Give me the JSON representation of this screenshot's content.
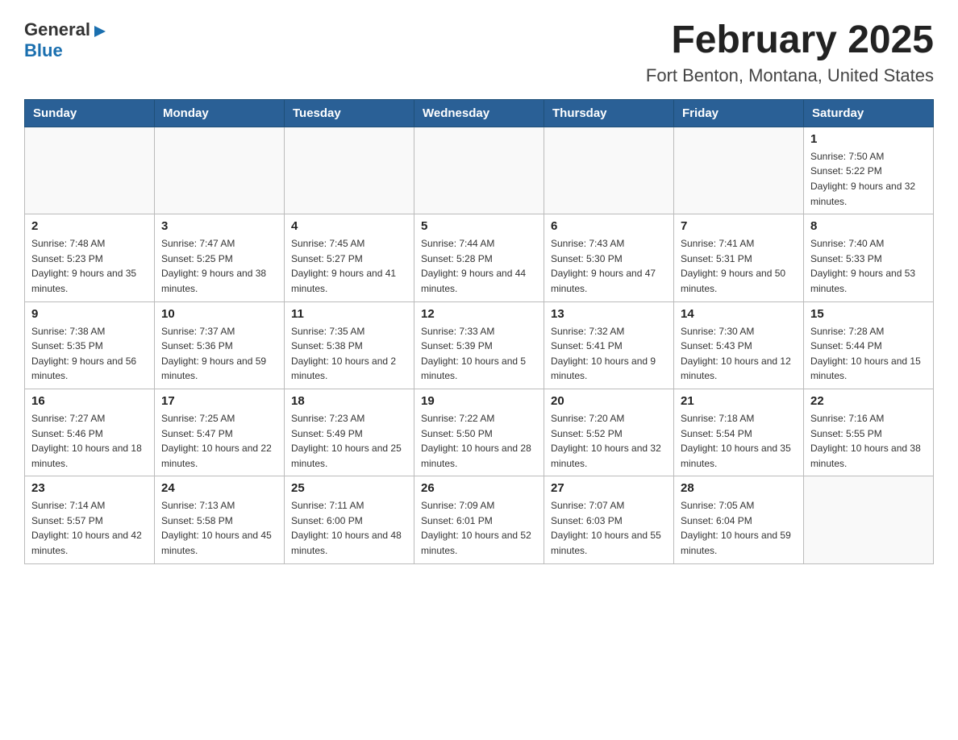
{
  "header": {
    "logo": {
      "general": "General",
      "blue": "Blue"
    },
    "title": "February 2025",
    "subtitle": "Fort Benton, Montana, United States"
  },
  "days_of_week": [
    "Sunday",
    "Monday",
    "Tuesday",
    "Wednesday",
    "Thursday",
    "Friday",
    "Saturday"
  ],
  "weeks": [
    [
      {
        "day": "",
        "info": ""
      },
      {
        "day": "",
        "info": ""
      },
      {
        "day": "",
        "info": ""
      },
      {
        "day": "",
        "info": ""
      },
      {
        "day": "",
        "info": ""
      },
      {
        "day": "",
        "info": ""
      },
      {
        "day": "1",
        "info": "Sunrise: 7:50 AM\nSunset: 5:22 PM\nDaylight: 9 hours and 32 minutes."
      }
    ],
    [
      {
        "day": "2",
        "info": "Sunrise: 7:48 AM\nSunset: 5:23 PM\nDaylight: 9 hours and 35 minutes."
      },
      {
        "day": "3",
        "info": "Sunrise: 7:47 AM\nSunset: 5:25 PM\nDaylight: 9 hours and 38 minutes."
      },
      {
        "day": "4",
        "info": "Sunrise: 7:45 AM\nSunset: 5:27 PM\nDaylight: 9 hours and 41 minutes."
      },
      {
        "day": "5",
        "info": "Sunrise: 7:44 AM\nSunset: 5:28 PM\nDaylight: 9 hours and 44 minutes."
      },
      {
        "day": "6",
        "info": "Sunrise: 7:43 AM\nSunset: 5:30 PM\nDaylight: 9 hours and 47 minutes."
      },
      {
        "day": "7",
        "info": "Sunrise: 7:41 AM\nSunset: 5:31 PM\nDaylight: 9 hours and 50 minutes."
      },
      {
        "day": "8",
        "info": "Sunrise: 7:40 AM\nSunset: 5:33 PM\nDaylight: 9 hours and 53 minutes."
      }
    ],
    [
      {
        "day": "9",
        "info": "Sunrise: 7:38 AM\nSunset: 5:35 PM\nDaylight: 9 hours and 56 minutes."
      },
      {
        "day": "10",
        "info": "Sunrise: 7:37 AM\nSunset: 5:36 PM\nDaylight: 9 hours and 59 minutes."
      },
      {
        "day": "11",
        "info": "Sunrise: 7:35 AM\nSunset: 5:38 PM\nDaylight: 10 hours and 2 minutes."
      },
      {
        "day": "12",
        "info": "Sunrise: 7:33 AM\nSunset: 5:39 PM\nDaylight: 10 hours and 5 minutes."
      },
      {
        "day": "13",
        "info": "Sunrise: 7:32 AM\nSunset: 5:41 PM\nDaylight: 10 hours and 9 minutes."
      },
      {
        "day": "14",
        "info": "Sunrise: 7:30 AM\nSunset: 5:43 PM\nDaylight: 10 hours and 12 minutes."
      },
      {
        "day": "15",
        "info": "Sunrise: 7:28 AM\nSunset: 5:44 PM\nDaylight: 10 hours and 15 minutes."
      }
    ],
    [
      {
        "day": "16",
        "info": "Sunrise: 7:27 AM\nSunset: 5:46 PM\nDaylight: 10 hours and 18 minutes."
      },
      {
        "day": "17",
        "info": "Sunrise: 7:25 AM\nSunset: 5:47 PM\nDaylight: 10 hours and 22 minutes."
      },
      {
        "day": "18",
        "info": "Sunrise: 7:23 AM\nSunset: 5:49 PM\nDaylight: 10 hours and 25 minutes."
      },
      {
        "day": "19",
        "info": "Sunrise: 7:22 AM\nSunset: 5:50 PM\nDaylight: 10 hours and 28 minutes."
      },
      {
        "day": "20",
        "info": "Sunrise: 7:20 AM\nSunset: 5:52 PM\nDaylight: 10 hours and 32 minutes."
      },
      {
        "day": "21",
        "info": "Sunrise: 7:18 AM\nSunset: 5:54 PM\nDaylight: 10 hours and 35 minutes."
      },
      {
        "day": "22",
        "info": "Sunrise: 7:16 AM\nSunset: 5:55 PM\nDaylight: 10 hours and 38 minutes."
      }
    ],
    [
      {
        "day": "23",
        "info": "Sunrise: 7:14 AM\nSunset: 5:57 PM\nDaylight: 10 hours and 42 minutes."
      },
      {
        "day": "24",
        "info": "Sunrise: 7:13 AM\nSunset: 5:58 PM\nDaylight: 10 hours and 45 minutes."
      },
      {
        "day": "25",
        "info": "Sunrise: 7:11 AM\nSunset: 6:00 PM\nDaylight: 10 hours and 48 minutes."
      },
      {
        "day": "26",
        "info": "Sunrise: 7:09 AM\nSunset: 6:01 PM\nDaylight: 10 hours and 52 minutes."
      },
      {
        "day": "27",
        "info": "Sunrise: 7:07 AM\nSunset: 6:03 PM\nDaylight: 10 hours and 55 minutes."
      },
      {
        "day": "28",
        "info": "Sunrise: 7:05 AM\nSunset: 6:04 PM\nDaylight: 10 hours and 59 minutes."
      },
      {
        "day": "",
        "info": ""
      }
    ]
  ]
}
